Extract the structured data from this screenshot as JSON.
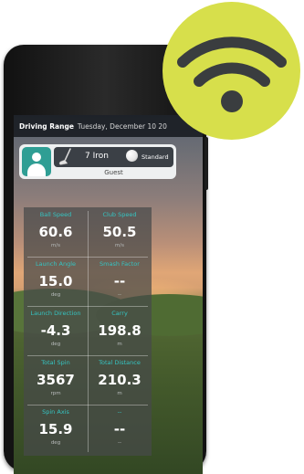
{
  "header": {
    "mode": "Driving Range",
    "date": "Tuesday, December 10 20"
  },
  "player": {
    "name": "Guest",
    "club": "7 Iron",
    "ball": "Standard"
  },
  "stats": [
    {
      "label": "Ball Speed",
      "value": "60.6",
      "unit": "m/s"
    },
    {
      "label": "Club Speed",
      "value": "50.5",
      "unit": "m/s"
    },
    {
      "label": "Launch Angle",
      "value": "15.0",
      "unit": "deg"
    },
    {
      "label": "Smash Factor",
      "value": "--",
      "unit": "--"
    },
    {
      "label": "Launch Direction",
      "value": "-4.3",
      "unit": "deg"
    },
    {
      "label": "Carry",
      "value": "198.8",
      "unit": "m"
    },
    {
      "label": "Total Spin",
      "value": "3567",
      "unit": "rpm"
    },
    {
      "label": "Total Distance",
      "value": "210.3",
      "unit": "m"
    },
    {
      "label": "Spin Axis",
      "value": "15.9",
      "unit": "deg"
    },
    {
      "label": "--",
      "value": "--",
      "unit": "--"
    }
  ],
  "badge": {
    "icon": "wifi-icon",
    "color": "#d7df4b"
  }
}
